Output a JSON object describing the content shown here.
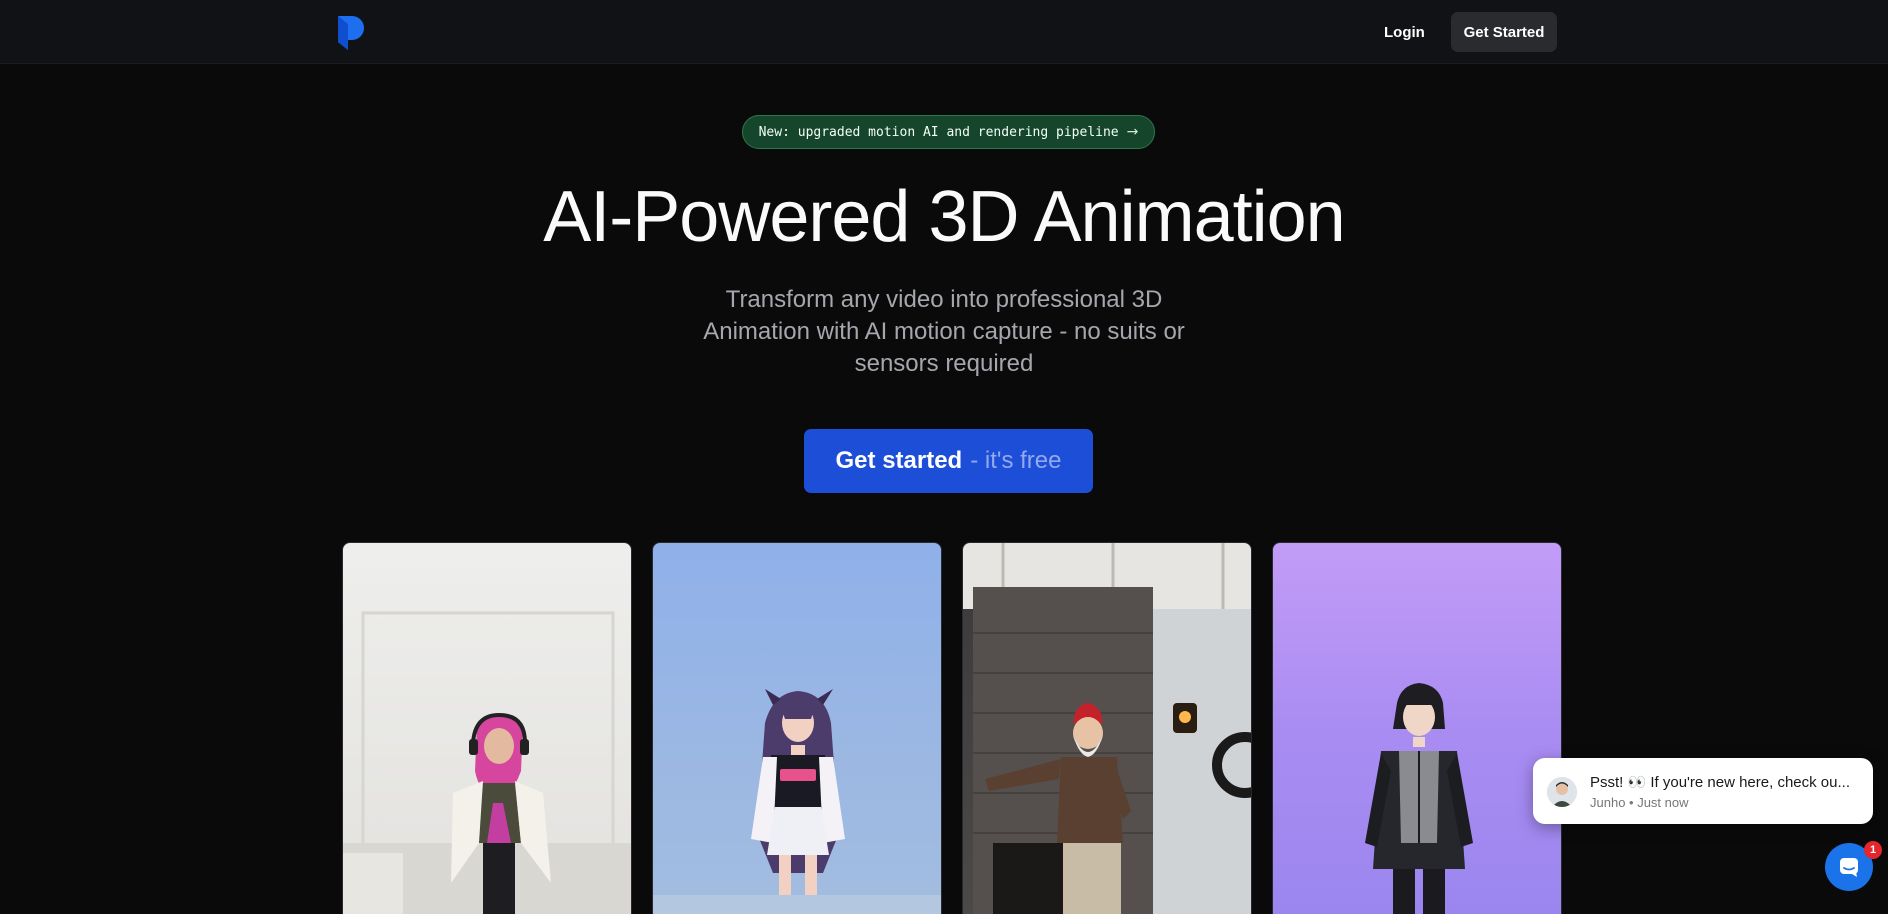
{
  "nav": {
    "login_label": "Login",
    "get_started_label": "Get Started"
  },
  "announcement": {
    "text": "New: upgraded motion AI and rendering pipeline",
    "icon": "arrow-right-icon"
  },
  "hero": {
    "title": "AI-Powered 3D Animation",
    "subtitle": "Transform any video into professional 3D Animation with AI motion capture - no suits or sensors required",
    "cta_main": "Get started",
    "cta_suffix": "- it's free"
  },
  "cards": [
    {
      "subject": "woman-with-headphones-video"
    },
    {
      "subject": "anime-girl-3d-character"
    },
    {
      "subject": "man-in-red-beanie-dancing-video"
    },
    {
      "subject": "anime-boy-3d-character"
    }
  ],
  "chat": {
    "message": "Psst! 👀 If you're new here, check ou...",
    "meta": "Junho • Just now",
    "badge_count": "1"
  },
  "colors": {
    "background": "#0a0a0b",
    "nav_bg": "#111215",
    "cta_blue": "#1d4ed8",
    "pill_green": "#15452a",
    "chat_blue": "#1a73e8",
    "badge_red": "#e5262b"
  }
}
